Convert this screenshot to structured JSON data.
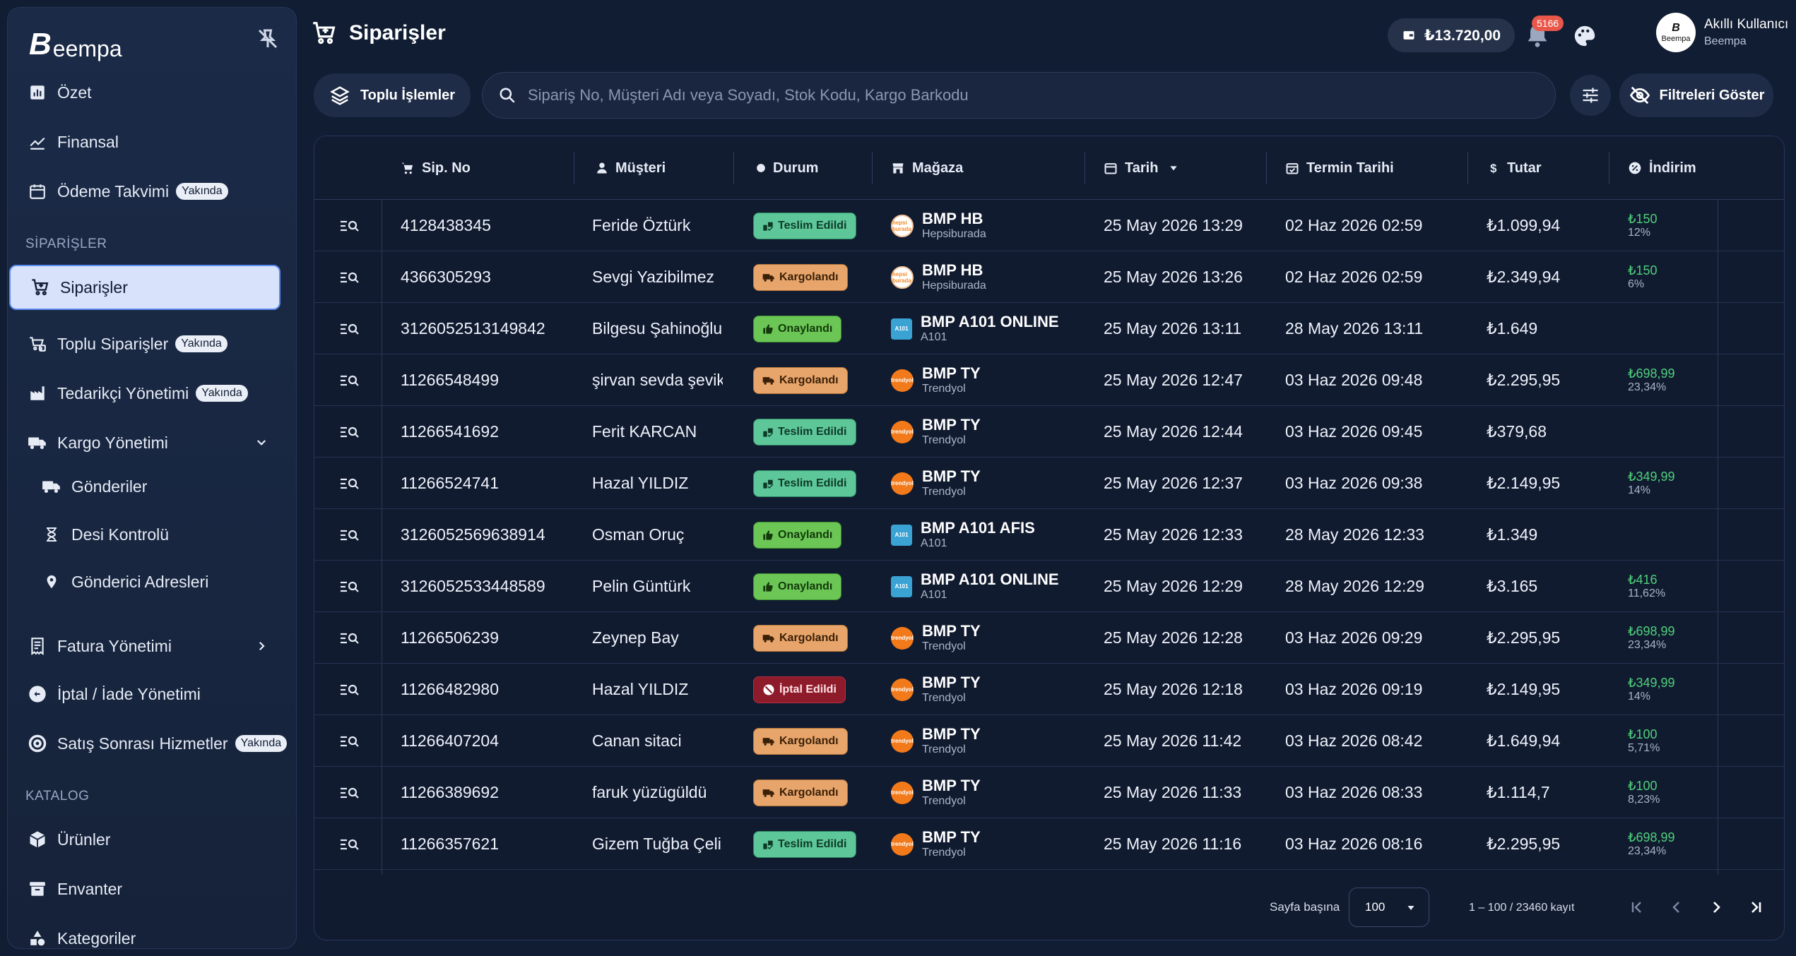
{
  "app": {
    "logo_mark": "B",
    "logo_text": "eempa"
  },
  "sidebar": {
    "items": [
      {
        "label": "Özet",
        "icon": "chart-icon"
      },
      {
        "label": "Finansal",
        "icon": "trend-icon"
      },
      {
        "label": "Ödeme Takvimi",
        "icon": "calendar-icon",
        "badge": "Yakında"
      }
    ],
    "section_orders": "SİPARİŞLER",
    "order_items": [
      {
        "label": "Siparişler",
        "icon": "cart-icon",
        "active": true
      },
      {
        "label": "Toplu Siparişler",
        "icon": "bulk-cart-icon",
        "badge": "Yakında"
      },
      {
        "label": "Tedarikçi Yönetimi",
        "icon": "factory-icon",
        "badge": "Yakında"
      },
      {
        "label": "Kargo Yönetimi",
        "icon": "truck-icon",
        "expanded": true
      },
      {
        "label": "Gönderiler",
        "icon": "truck-icon"
      },
      {
        "label": "Desi Kontrolü",
        "icon": "hourglass-icon"
      },
      {
        "label": "Gönderici Adresleri",
        "icon": "location-icon"
      },
      {
        "label": "Fatura Yönetimi",
        "icon": "receipt-icon"
      },
      {
        "label": "İptal / İade Yönetimi",
        "icon": "return-icon"
      },
      {
        "label": "Satış Sonrası Hizmetler",
        "icon": "support-icon",
        "badge": "Yakında"
      }
    ],
    "section_catalog": "KATALOG",
    "catalog_items": [
      {
        "label": "Ürünler",
        "icon": "box-icon"
      },
      {
        "label": "Envanter",
        "icon": "archive-icon"
      },
      {
        "label": "Kategoriler",
        "icon": "category-icon"
      }
    ]
  },
  "header": {
    "title": "Siparişler",
    "balance": "₺13.720,00",
    "notifications": "5166",
    "user_name": "Akıllı Kullanıcı",
    "user_org": "Beempa",
    "avatar_text": "Beempa"
  },
  "toolbar": {
    "bulk_label": "Toplu İşlemler",
    "search_placeholder": "Sipariş No, Müşteri Adı veya Soyadı, Stok Kodu, Kargo Barkodu",
    "filter_label": "Filtreleri Göster"
  },
  "table": {
    "columns": [
      "Sip. No",
      "Müşteri",
      "Durum",
      "Mağaza",
      "Tarih",
      "Termin Tarihi",
      "Tutar",
      "İndirim"
    ],
    "rows": [
      {
        "no": "4128438345",
        "customer": "Feride Öztürk",
        "status": "Teslim Edildi",
        "status_type": "delivered",
        "store": "BMP HB",
        "platform": "Hepsiburada",
        "logo": "hb",
        "date": "25 May 2026 13:29",
        "due": "02 Haz 2026 02:59",
        "amount": "₺1.099,94",
        "discount": "₺150",
        "discount_pct": "12%"
      },
      {
        "no": "4366305293",
        "customer": "Sevgi Yazibilmez",
        "status": "Kargolandı",
        "status_type": "shipped",
        "store": "BMP HB",
        "platform": "Hepsiburada",
        "logo": "hb",
        "date": "25 May 2026 13:26",
        "due": "02 Haz 2026 02:59",
        "amount": "₺2.349,94",
        "discount": "₺150",
        "discount_pct": "6%"
      },
      {
        "no": "3126052513149842",
        "customer": "Bilgesu Şahinoğlu",
        "status": "Onaylandı",
        "status_type": "approved",
        "store": "BMP A101 ONLINE",
        "platform": "A101",
        "logo": "a101",
        "date": "25 May 2026 13:11",
        "due": "28 May 2026 13:11",
        "amount": "₺1.649",
        "discount": "",
        "discount_pct": ""
      },
      {
        "no": "11266548499",
        "customer": "şirvan sevda şevik",
        "status": "Kargolandı",
        "status_type": "shipped",
        "store": "BMP TY",
        "platform": "Trendyol",
        "logo": "ty",
        "date": "25 May 2026 12:47",
        "due": "03 Haz 2026 09:48",
        "amount": "₺2.295,95",
        "discount": "₺698,99",
        "discount_pct": "23,34%"
      },
      {
        "no": "11266541692",
        "customer": "Ferit KARCAN",
        "status": "Teslim Edildi",
        "status_type": "delivered",
        "store": "BMP TY",
        "platform": "Trendyol",
        "logo": "ty",
        "date": "25 May 2026 12:44",
        "due": "03 Haz 2026 09:45",
        "amount": "₺379,68",
        "discount": "",
        "discount_pct": ""
      },
      {
        "no": "11266524741",
        "customer": "Hazal YILDIZ",
        "status": "Teslim Edildi",
        "status_type": "delivered",
        "store": "BMP TY",
        "platform": "Trendyol",
        "logo": "ty",
        "date": "25 May 2026 12:37",
        "due": "03 Haz 2026 09:38",
        "amount": "₺2.149,95",
        "discount": "₺349,99",
        "discount_pct": "14%"
      },
      {
        "no": "3126052569638914",
        "customer": "Osman Oruç",
        "status": "Onaylandı",
        "status_type": "approved",
        "store": "BMP A101 AFIS",
        "platform": "A101",
        "logo": "a101",
        "date": "25 May 2026 12:33",
        "due": "28 May 2026 12:33",
        "amount": "₺1.349",
        "discount": "",
        "discount_pct": ""
      },
      {
        "no": "3126052533448589",
        "customer": "Pelin Güntürk",
        "status": "Onaylandı",
        "status_type": "approved",
        "store": "BMP A101 ONLINE",
        "platform": "A101",
        "logo": "a101",
        "date": "25 May 2026 12:29",
        "due": "28 May 2026 12:29",
        "amount": "₺3.165",
        "discount": "₺416",
        "discount_pct": "11,62%"
      },
      {
        "no": "11266506239",
        "customer": "Zeynep Bay",
        "status": "Kargolandı",
        "status_type": "shipped",
        "store": "BMP TY",
        "platform": "Trendyol",
        "logo": "ty",
        "date": "25 May 2026 12:28",
        "due": "03 Haz 2026 09:29",
        "amount": "₺2.295,95",
        "discount": "₺698,99",
        "discount_pct": "23,34%"
      },
      {
        "no": "11266482980",
        "customer": "Hazal YILDIZ",
        "status": "İptal Edildi",
        "status_type": "cancelled",
        "store": "BMP TY",
        "platform": "Trendyol",
        "logo": "ty",
        "date": "25 May 2026 12:18",
        "due": "03 Haz 2026 09:19",
        "amount": "₺2.149,95",
        "discount": "₺349,99",
        "discount_pct": "14%"
      },
      {
        "no": "11266407204",
        "customer": "Canan sitaci",
        "status": "Kargolandı",
        "status_type": "shipped",
        "store": "BMP TY",
        "platform": "Trendyol",
        "logo": "ty",
        "date": "25 May 2026 11:42",
        "due": "03 Haz 2026 08:42",
        "amount": "₺1.649,94",
        "discount": "₺100",
        "discount_pct": "5,71%"
      },
      {
        "no": "11266389692",
        "customer": "faruk yüzügüldü",
        "status": "Kargolandı",
        "status_type": "shipped",
        "store": "BMP TY",
        "platform": "Trendyol",
        "logo": "ty",
        "date": "25 May 2026 11:33",
        "due": "03 Haz 2026 08:33",
        "amount": "₺1.114,7",
        "discount": "₺100",
        "discount_pct": "8,23%"
      },
      {
        "no": "11266357621",
        "customer": "Gizem Tuğba Çeli",
        "status": "Teslim Edildi",
        "status_type": "delivered",
        "store": "BMP TY",
        "platform": "Trendyol",
        "logo": "ty",
        "date": "25 May 2026 11:16",
        "due": "03 Haz 2026 08:16",
        "amount": "₺2.295,95",
        "discount": "₺698,99",
        "discount_pct": "23,34%"
      }
    ]
  },
  "footer": {
    "per_page_label": "Sayfa başına",
    "per_page_value": "100",
    "range": "1 – 100 / 23460 kayıt"
  },
  "logo_texts": {
    "hb": "hepsi burada",
    "ty": "trendyol",
    "a101": "A101"
  },
  "colors": {
    "accent": "#5b8cf0",
    "discount": "#4fd17b",
    "background": "#111d33"
  }
}
